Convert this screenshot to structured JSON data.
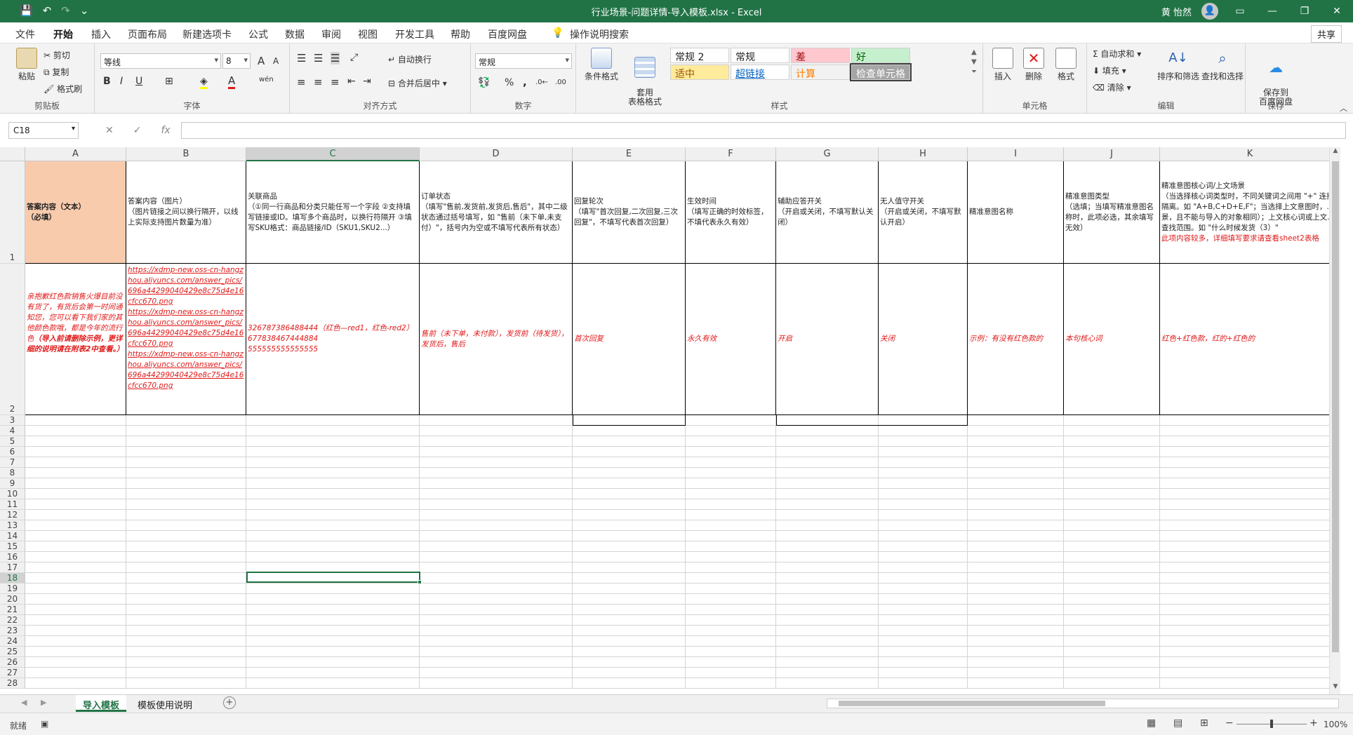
{
  "titlebar": {
    "title": "行业场景-问题详情-导入模板.xlsx  -  Excel",
    "user": "黄 怡然",
    "save_icon": "💾",
    "undo_icon": "↶",
    "redo_icon": "↷",
    "more_icon": "⌄",
    "avatar_icon": "👤",
    "ribbon_display_icon": "▭",
    "minimize_icon": "—",
    "restore_icon": "❐",
    "close_icon": "✕"
  },
  "menu": {
    "tabs": [
      "文件",
      "开始",
      "插入",
      "页面布局",
      "新建选项卡",
      "公式",
      "数据",
      "审阅",
      "视图",
      "开发工具",
      "帮助",
      "百度网盘"
    ],
    "search": "操作说明搜索",
    "share": "共享"
  },
  "ribbon": {
    "clipboard": {
      "paste": "粘贴",
      "cut": "剪切",
      "copy": "复制",
      "format_painter": "格式刷",
      "label": "剪贴板"
    },
    "font": {
      "name": "等线",
      "size": "8",
      "grow": "A",
      "shrink": "A",
      "bold": "B",
      "italic": "I",
      "underline": "U",
      "font_color": "A",
      "wen": "wén",
      "label": "字体"
    },
    "alignment": {
      "wrap": "自动换行",
      "merge": "合并后居中",
      "label": "对齐方式"
    },
    "number": {
      "format": "常规",
      "percent": "%",
      "comma": ",",
      "label": "数字"
    },
    "styles": {
      "conditional": "条件格式",
      "table_format": "套用\n表格格式",
      "cells": [
        {
          "text": "常规 2",
          "bg": "#ffffff",
          "color": "#222222"
        },
        {
          "text": "常规",
          "bg": "#ffffff",
          "color": "#222222"
        },
        {
          "text": "差",
          "bg": "#ffc7ce",
          "color": "#9c0006"
        },
        {
          "text": "好",
          "bg": "#c6efce",
          "color": "#006100"
        },
        {
          "text": "适中",
          "bg": "#ffeb9c",
          "color": "#9c5700"
        },
        {
          "text": "超链接",
          "bg": "#ffffff",
          "color": "#0563c1"
        },
        {
          "text": "计算",
          "bg": "#f2f2f2",
          "color": "#fa7d00"
        },
        {
          "text": "检查单元格",
          "bg": "#a5a5a5",
          "color": "#ffffff"
        }
      ],
      "label": "样式"
    },
    "cells": {
      "insert": "插入",
      "delete": "删除",
      "format": "格式",
      "label": "单元格"
    },
    "editing": {
      "autosum": "自动求和",
      "fill": "填充",
      "clear": "清除",
      "sort": "排序和筛选",
      "find": "查找和选择",
      "label": "编辑"
    },
    "save": {
      "save_baidu": "保存到\n百度网盘",
      "label": "保存"
    }
  },
  "formula": {
    "namebox": "C18",
    "fx": "fx",
    "value": ""
  },
  "columns": [
    "A",
    "B",
    "C",
    "D",
    "E",
    "F",
    "G",
    "H",
    "I",
    "J",
    "K"
  ],
  "rows": [
    "1",
    "2",
    "3",
    "4",
    "5",
    "6",
    "7",
    "8",
    "9",
    "10",
    "11",
    "12",
    "13",
    "14",
    "15",
    "16",
    "17",
    "18",
    "19",
    "20",
    "21",
    "22",
    "23",
    "24",
    "25",
    "26",
    "27",
    "28"
  ],
  "header_row": {
    "A": "答案内容（文本）\n（必填）",
    "B": "答案内容（图片）\n（图片链接之间以换行隔开，以线上实际支持图片数量为准）",
    "C": "关联商品\n（①同一行商品和分类只能任写一个字段 ②支持填写链接或ID。填写多个商品时，以换行符隔开 ③填写SKU格式：商品链接/ID（SKU1,SKU2...）",
    "D": "订单状态\n（填写\"售前,发货前,发货后,售后\"，其中二级状态通过括号填写，如 \"售前（未下单,未支付）\"，括号内为空或不填写代表所有状态）",
    "E": "回复轮次\n（填写\"首次回复,二次回复,三次回复\"，不填写代表首次回复）",
    "F": "生效时间\n（填写正确的时效标签，不填代表永久有效）",
    "G": "辅助应答开关\n（开启或关闭，不填写默认关闭）",
    "H": "无人值守开关\n（开启或关闭，不填写默认开启）",
    "I": "精准意图名称",
    "J": "精准意图类型\n（选填；当填写精准意图名称时，此项必选，其余填写无效）",
    "K_title": "精准意图核心词/上文场景\n（当选择核心词类型时，不同关键词之间用 \"+\" 连接隔离。如 \"A+B,C+D+E,F\"；当选择上文意图时，...景，且不能与导入的对象相同）；上文核心词或上文...查找范围。如 \"什么时候发货（3）\"",
    "K_note": "此项内容较多，详细填写要求请查看sheet2表格"
  },
  "data_row": {
    "A": "亲抱歉红色款销售火爆目前没有货了，有货后会第一时间通知您，您可以看下我们家的其他颜色款哦，都是今年的流行色",
    "A_bold": "（导入前请删除示例，更详细的说明请在附表2中查看。）",
    "B_links": [
      "https://xdmp-new.oss-cn-hangzhou.aliyuncs.com/answer_pics/696a44299040429e8c75d4e16cfcc670.png",
      "https://xdmp-new.oss-cn-hangzhou.aliyuncs.com/answer_pics/696a44299040429e8c75d4e16cfcc670.png",
      "https://xdmp-new.oss-cn-hangzhou.aliyuncs.com/answer_pics/696a44299040429e8c75d4e16cfcc670.png"
    ],
    "C_lines": [
      "326787386488444（红色—red1，红色-red2）",
      "677838467444884",
      "555555555555555"
    ],
    "D": "售前（未下单，未付款），发货前（待发货），发货后，售后",
    "E": "首次回复",
    "F": "永久有效",
    "G": "开启",
    "H": "关闭",
    "I": "示例：有没有红色款的",
    "J": "本句核心词",
    "K": "红色+红色款，红的+红色的"
  },
  "sheets": {
    "tabs": [
      "导入模板",
      "模板使用说明"
    ],
    "add": "+"
  },
  "status": {
    "ready": "就绪",
    "zoom": "100%"
  }
}
